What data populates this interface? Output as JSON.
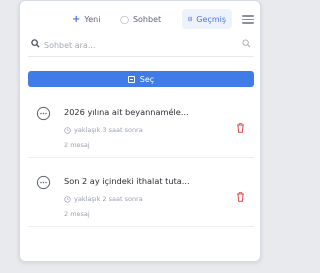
{
  "tabs": {
    "new_label": "Yeni",
    "chat_label": "Sohbet",
    "history_label": "Geçmiş"
  },
  "search": {
    "placeholder": "Sohbet ara...",
    "value": ""
  },
  "select_button": {
    "label": "Seç"
  },
  "history_items": [
    {
      "title": "2026 yılına ait beyannaméle...",
      "time": "yaklaşık 3 saat sonra",
      "count": "2 mesaj"
    },
    {
      "title": "Son 2 ay içindeki ithalat tuta...",
      "time": "yaklaşık 2 saat sonra",
      "count": "2 mesaj"
    }
  ],
  "colors": {
    "accent": "#3f7ce8",
    "delete": "#e0474c",
    "muted_text": "#9aa1ad"
  },
  "icons": {
    "new": "plus-icon",
    "chat": "chat-icon",
    "history": "history-icon",
    "menu": "menu-icon",
    "search": "search-icon",
    "select": "checkbox-icon",
    "item": "chat-bubble-icon",
    "time": "clock-icon",
    "delete": "trash-icon"
  }
}
